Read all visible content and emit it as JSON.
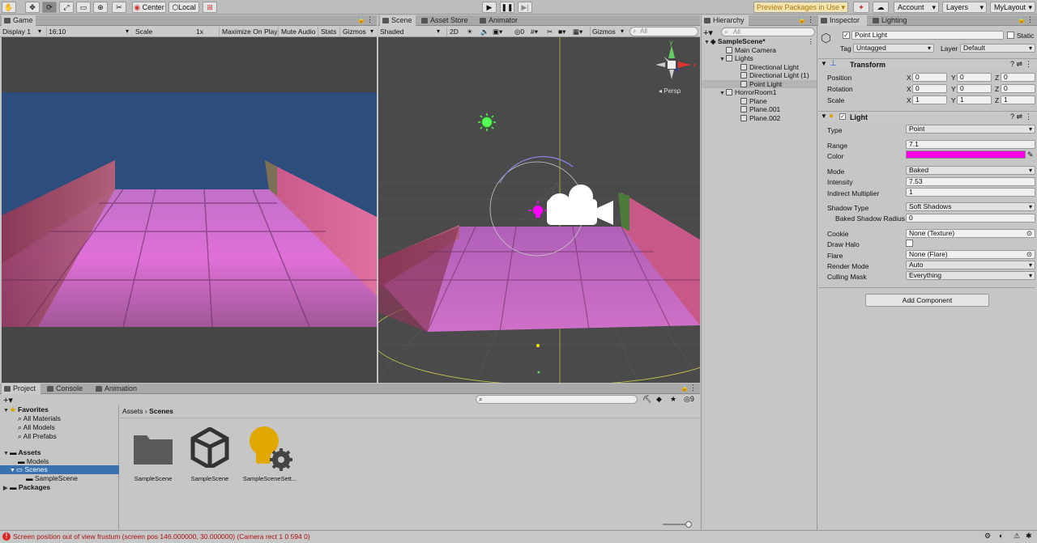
{
  "toolbar": {
    "pivot_center": "Center",
    "pivot_local": "Local",
    "preview_packages": "Preview Packages in Use",
    "account": "Account",
    "layers": "Layers",
    "layout": "MyLayout"
  },
  "game": {
    "tab": "Game",
    "display": "Display 1",
    "aspect": "16:10",
    "scale_label": "Scale",
    "scale_value": "1x",
    "maximize": "Maximize On Play",
    "mute": "Mute Audio",
    "stats": "Stats",
    "gizmos": "Gizmos"
  },
  "scene": {
    "tabs": [
      "Scene",
      "Asset Store",
      "Animator"
    ],
    "shading": "Shaded",
    "mode_2d": "2D",
    "hidden_count": "0",
    "gizmos": "Gizmos",
    "search_placeholder": "All",
    "persp": "Persp"
  },
  "hierarchy": {
    "tab": "Hierarchy",
    "search_placeholder": "All",
    "items": [
      {
        "label": "SampleScene*"
      },
      {
        "label": "Main Camera"
      },
      {
        "label": "Lights"
      },
      {
        "label": "Directional Light"
      },
      {
        "label": "Directional Light (1)"
      },
      {
        "label": "Point Light"
      },
      {
        "label": "HorrorRoom1"
      },
      {
        "label": "Plane"
      },
      {
        "label": "Plane.001"
      },
      {
        "label": "Plane.002"
      }
    ]
  },
  "inspector": {
    "tabs": [
      "Inspector",
      "Lighting"
    ],
    "object_name": "Point Light",
    "static_label": "Static",
    "tag_label": "Tag",
    "tag_value": "Untagged",
    "layer_label": "Layer",
    "layer_value": "Default",
    "transform": {
      "title": "Transform",
      "rows": [
        {
          "label": "Position",
          "x": "0",
          "y": "0",
          "z": "0"
        },
        {
          "label": "Rotation",
          "x": "0",
          "y": "0",
          "z": "0"
        },
        {
          "label": "Scale",
          "x": "1",
          "y": "1",
          "z": "1"
        }
      ],
      "axis_x": "X",
      "axis_y": "Y",
      "axis_z": "Z"
    },
    "light": {
      "title": "Light",
      "type_label": "Type",
      "type_value": "Point",
      "range_label": "Range",
      "range_value": "7.1",
      "color_label": "Color",
      "color_value": "#ff00e6",
      "mode_label": "Mode",
      "mode_value": "Baked",
      "intensity_label": "Intensity",
      "intensity_value": "7.53",
      "indirect_label": "Indirect Multiplier",
      "indirect_value": "1",
      "shadow_label": "Shadow Type",
      "shadow_value": "Soft Shadows",
      "baked_radius_label": "Baked Shadow Radius",
      "baked_radius_value": "0",
      "cookie_label": "Cookie",
      "cookie_value": "None (Texture)",
      "halo_label": "Draw Halo",
      "flare_label": "Flare",
      "flare_value": "None (Flare)",
      "render_mode_label": "Render Mode",
      "render_mode_value": "Auto",
      "culling_label": "Culling Mask",
      "culling_value": "Everything"
    },
    "add_component": "Add Component"
  },
  "project": {
    "tabs": [
      "Project",
      "Console",
      "Animation"
    ],
    "hidden_count": "9",
    "favorites": {
      "label": "Favorites",
      "items": [
        "All Materials",
        "All Models",
        "All Prefabs"
      ]
    },
    "assets": {
      "label": "Assets",
      "items": [
        "Models",
        "Scenes",
        "SampleScene"
      ]
    },
    "packages": "Packages",
    "breadcrumb": [
      "Assets",
      "Scenes"
    ],
    "files": [
      "SampleScene",
      "SampleScene",
      "SampleSceneSett..."
    ]
  },
  "status": {
    "message": "Screen position out of view frustum (screen pos 146.000000, 30.000000) (Camera rect 1 0 594 0)"
  }
}
